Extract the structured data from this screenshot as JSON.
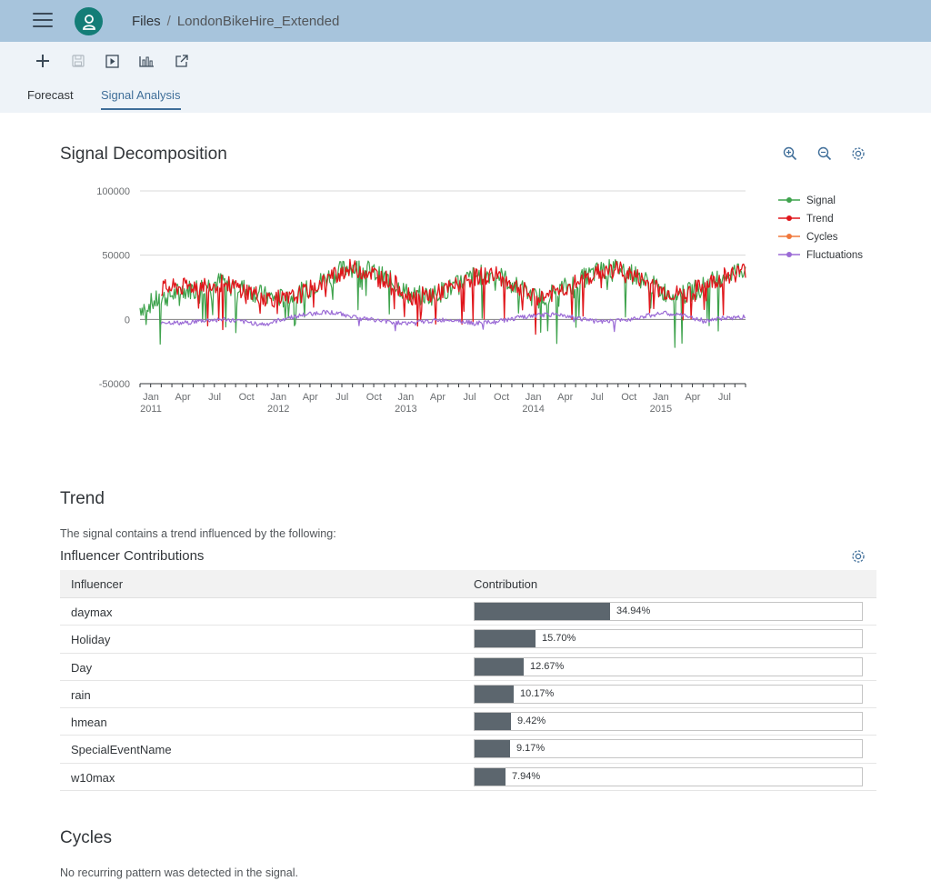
{
  "breadcrumb": {
    "root": "Files",
    "separator": "/",
    "current": "LondonBikeHire_Extended"
  },
  "toolbar": {
    "icons": [
      "add-icon",
      "save-icon",
      "run-icon",
      "chart-icon",
      "export-icon"
    ]
  },
  "tabs": [
    {
      "label": "Forecast",
      "active": false
    },
    {
      "label": "Signal Analysis",
      "active": true
    }
  ],
  "signal_section": {
    "title": "Signal Decomposition"
  },
  "chart_data": {
    "type": "line",
    "title": "",
    "ylim": [
      -50000,
      100000
    ],
    "yticks": [
      "100000",
      "50000",
      "0",
      "-50000"
    ],
    "x_month_labels": [
      "Jan",
      "Apr",
      "Jul",
      "Oct",
      "Jan",
      "Apr",
      "Jul",
      "Oct",
      "Jan",
      "Apr",
      "Jul",
      "Oct",
      "Jan",
      "Apr",
      "Jul",
      "Oct",
      "Jan",
      "Apr",
      "Jul"
    ],
    "x_year_labels": [
      "2011",
      "2012",
      "2013",
      "2014",
      "2015"
    ],
    "x_range": [
      "2011-01",
      "2015-09"
    ],
    "legend_position": "right",
    "series": [
      {
        "name": "Signal",
        "color": "#3fa34d",
        "values": [
          9000,
          16000,
          22000,
          26000,
          30000,
          24000,
          18000,
          16000,
          23000,
          33000,
          41000,
          38000,
          30000,
          18000,
          19000,
          25000,
          34000,
          36000,
          26000,
          16000,
          22000,
          30000,
          38000,
          40000,
          32000,
          22000,
          19000,
          26000,
          35000,
          40000
        ]
      },
      {
        "name": "Trend",
        "color": "#e0161b",
        "values": [
          null,
          24000,
          25000,
          27000,
          28000,
          23000,
          17000,
          15000,
          22000,
          32000,
          40000,
          37000,
          30000,
          18000,
          19000,
          25000,
          33000,
          35000,
          26000,
          16000,
          22000,
          29000,
          37000,
          39000,
          31000,
          22000,
          19000,
          26000,
          34000,
          38000
        ]
      },
      {
        "name": "Cycles",
        "color": "#f0783c",
        "values": []
      },
      {
        "name": "Fluctuations",
        "color": "#9b6bd6",
        "values": [
          null,
          -2000,
          -3000,
          -1000,
          0,
          -2000,
          -4000,
          1000,
          4000,
          6000,
          3000,
          0,
          -2000,
          -3000,
          -1000,
          0,
          -3000,
          -2000,
          1000,
          3000,
          4000,
          1000,
          -2000,
          -1000,
          2000,
          5000,
          3000,
          -1000,
          1000,
          2000
        ]
      }
    ]
  },
  "trend_section": {
    "title": "Trend",
    "description": "The signal contains a trend influenced by the following:",
    "subtitle": "Influencer Contributions",
    "table": {
      "headers": [
        "Influencer",
        "Contribution"
      ],
      "rows": [
        {
          "name": "daymax",
          "value": 34.94,
          "label": "34.94%"
        },
        {
          "name": "Holiday",
          "value": 15.7,
          "label": "15.70%"
        },
        {
          "name": "Day",
          "value": 12.67,
          "label": "12.67%"
        },
        {
          "name": "rain",
          "value": 10.17,
          "label": "10.17%"
        },
        {
          "name": "hmean",
          "value": 9.42,
          "label": "9.42%"
        },
        {
          "name": "SpecialEventName",
          "value": 9.17,
          "label": "9.17%"
        },
        {
          "name": "w10max",
          "value": 7.94,
          "label": "7.94%"
        }
      ]
    }
  },
  "cycles_section": {
    "title": "Cycles",
    "description": "No recurring pattern was detected in the signal."
  }
}
